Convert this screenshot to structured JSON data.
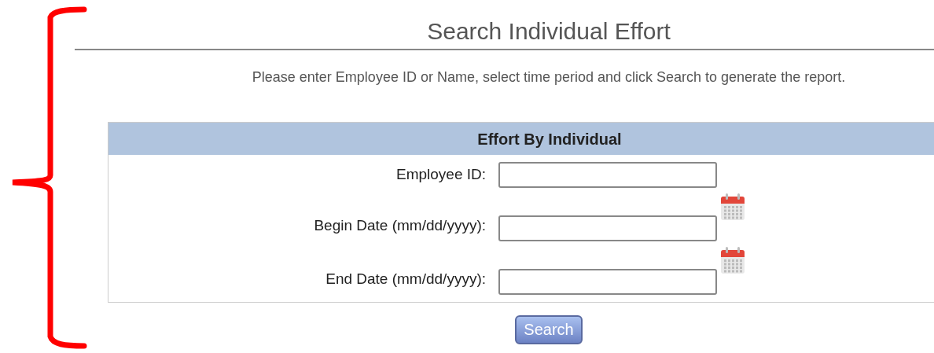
{
  "title": "Search Individual Effort",
  "instructions": "Please enter Employee ID or Name, select time period and click Search to generate the report.",
  "form": {
    "header": "Effort By Individual",
    "fields": [
      {
        "label": "Employee ID:",
        "kind": "text"
      },
      {
        "label": "Begin Date (mm/dd/yyyy):",
        "kind": "date"
      },
      {
        "label": "End Date (mm/dd/yyyy):",
        "kind": "date"
      }
    ],
    "button": "Search"
  }
}
